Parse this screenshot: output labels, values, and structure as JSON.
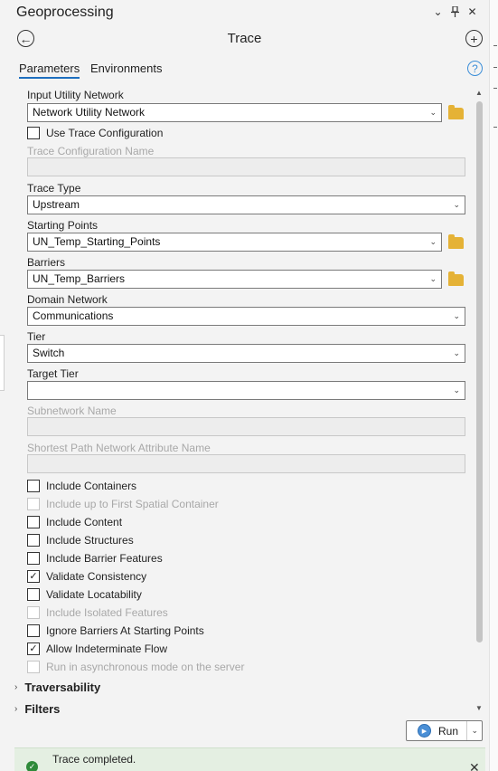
{
  "header": {
    "title": "Geoprocessing",
    "icons": [
      "chevron-down-icon",
      "pin-icon",
      "close-icon"
    ]
  },
  "tool": {
    "name": "Trace",
    "back_icon": "back-arrow-icon",
    "add_icon": "add-icon"
  },
  "tabs": [
    {
      "label": "Parameters",
      "active": true
    },
    {
      "label": "Environments",
      "active": false
    }
  ],
  "help_label": "?",
  "fields": {
    "input_utility_network": {
      "label": "Input Utility Network",
      "value": "Network Utility Network"
    },
    "use_trace_config": {
      "label": "Use Trace Configuration",
      "checked": false
    },
    "trace_config_name": {
      "label": "Trace Configuration Name",
      "value": ""
    },
    "trace_type": {
      "label": "Trace Type",
      "value": "Upstream"
    },
    "starting_points": {
      "label": "Starting Points",
      "value": "UN_Temp_Starting_Points"
    },
    "barriers": {
      "label": "Barriers",
      "value": "UN_Temp_Barriers"
    },
    "domain_network": {
      "label": "Domain Network",
      "value": "Communications"
    },
    "tier": {
      "label": "Tier",
      "value": "Switch"
    },
    "target_tier": {
      "label": "Target Tier",
      "value": ""
    },
    "subnetwork_name": {
      "label": "Subnetwork Name",
      "value": ""
    },
    "shortest_path": {
      "label": "Shortest Path Network Attribute Name",
      "value": ""
    }
  },
  "checkboxes": [
    {
      "label": "Include Containers",
      "checked": false,
      "enabled": true
    },
    {
      "label": "Include up to First Spatial Container",
      "checked": false,
      "enabled": false
    },
    {
      "label": "Include Content",
      "checked": false,
      "enabled": true
    },
    {
      "label": "Include Structures",
      "checked": false,
      "enabled": true
    },
    {
      "label": "Include Barrier Features",
      "checked": false,
      "enabled": true
    },
    {
      "label": "Validate Consistency",
      "checked": true,
      "enabled": true
    },
    {
      "label": "Validate Locatability",
      "checked": false,
      "enabled": true
    },
    {
      "label": "Include Isolated Features",
      "checked": false,
      "enabled": false
    },
    {
      "label": "Ignore Barriers At Starting Points",
      "checked": false,
      "enabled": true
    },
    {
      "label": "Allow Indeterminate Flow",
      "checked": true,
      "enabled": true
    },
    {
      "label": "Run in asynchronous mode on the server",
      "checked": false,
      "enabled": false
    }
  ],
  "sections": [
    "Traversability",
    "Filters"
  ],
  "run_button": {
    "label": "Run"
  },
  "status": {
    "message": "Trace completed.",
    "color": "#2f8a3a"
  },
  "colors": {
    "accent": "#1e6fbf",
    "folder": "#e5b236"
  }
}
